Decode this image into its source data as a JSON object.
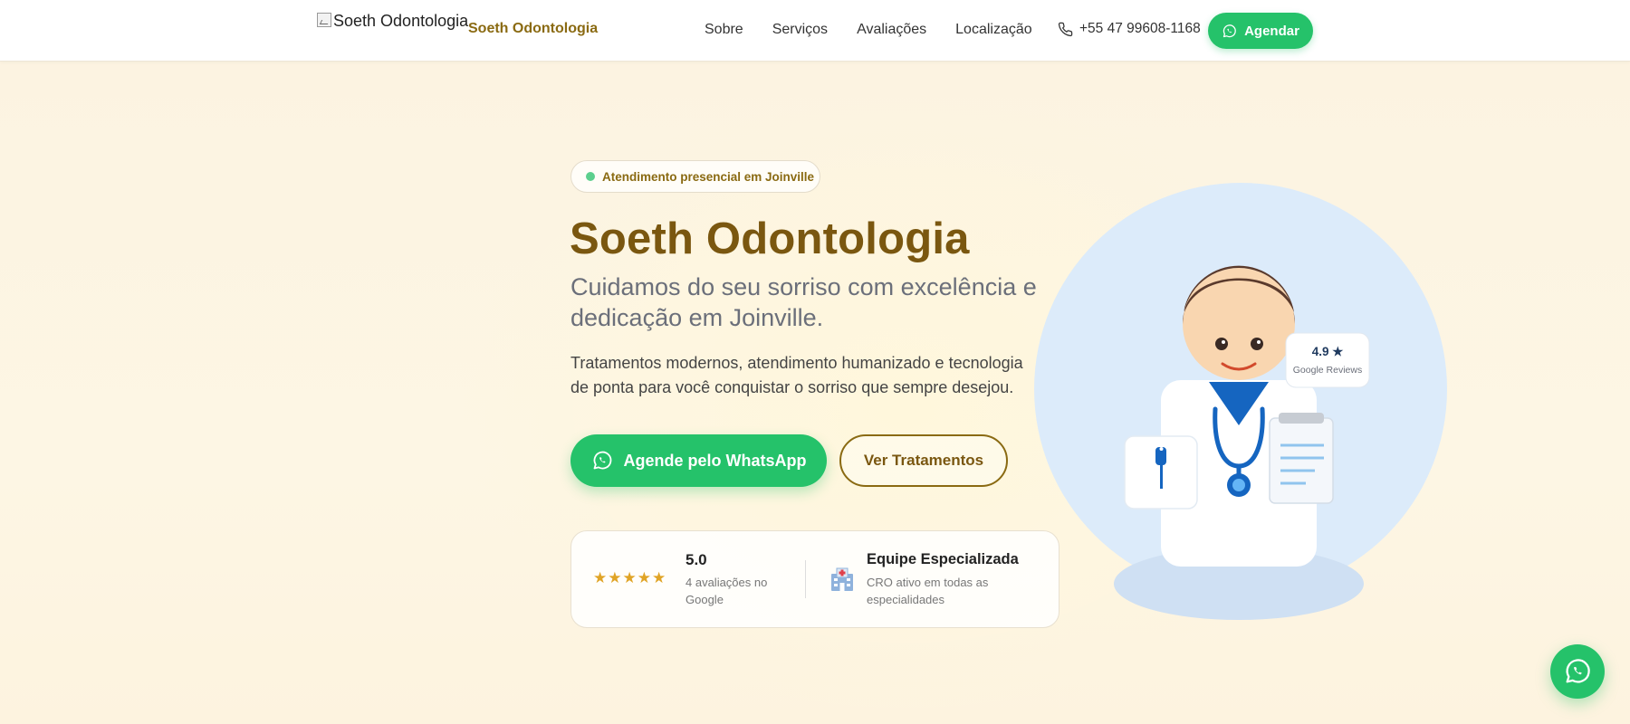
{
  "header": {
    "logo_alt": "Soeth Odontologia",
    "brand": "Soeth Odontologia",
    "nav": [
      {
        "label": "Sobre"
      },
      {
        "label": "Serviços"
      },
      {
        "label": "Avaliações"
      },
      {
        "label": "Localização"
      }
    ],
    "phone": "+55 47 99608-1168",
    "cta": "Agendar"
  },
  "hero": {
    "badge": "Atendimento presencial em Joinville",
    "title": "Soeth Odontologia",
    "subtitle": "Cuidamos do seu sorriso com excelência e dedicação em Joinville.",
    "description": "Tratamentos modernos, atendimento humanizado e tecnologia de ponta para você conquistar o sorriso que sempre desejou.",
    "primary_button": "Agende pelo WhatsApp",
    "secondary_button": "Ver Tratamentos"
  },
  "stats": {
    "stars": "★★★★★",
    "rating": "5.0",
    "rating_sub": "4 avaliações no Google",
    "team_title": "Equipe Especializada",
    "team_sub": "CRO ativo em todas as especialidades"
  },
  "illustration": {
    "review_score": "4.9 ★",
    "review_label": "Google Reviews"
  },
  "icons": {
    "phone": "phone-icon",
    "whatsapp": "whatsapp-icon",
    "hospital": "hospital-icon"
  },
  "colors": {
    "brand": "#7a5710",
    "accent_green": "#25c26a",
    "star": "#e0a426"
  }
}
